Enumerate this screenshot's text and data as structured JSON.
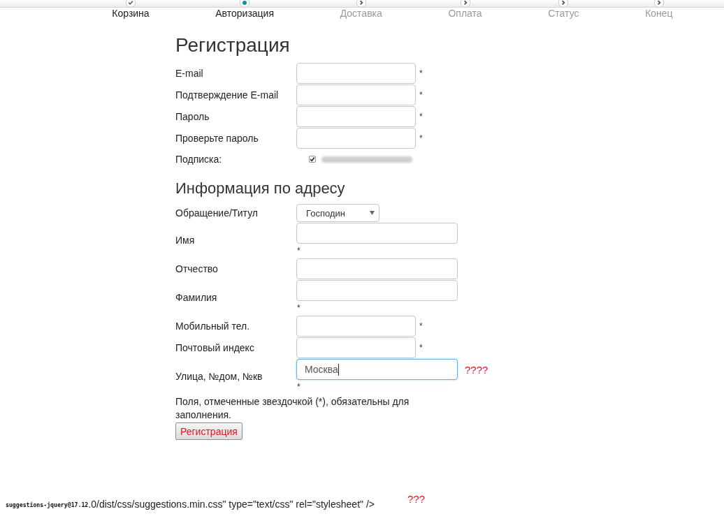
{
  "steps": [
    {
      "label": "Корзина",
      "done": true,
      "selected": false
    },
    {
      "label": "Авторизация",
      "done": false,
      "selected": true
    },
    {
      "label": "Доставка",
      "done": false,
      "selected": false
    },
    {
      "label": "Оплата",
      "done": false,
      "selected": false
    },
    {
      "label": "Статус",
      "done": false,
      "selected": false
    },
    {
      "label": "Конец",
      "done": false,
      "selected": false
    }
  ],
  "registration": {
    "title": "Регистрация",
    "fields": [
      {
        "kind": "short",
        "label": "E-mail",
        "required_mark": "*",
        "focused": false
      },
      {
        "kind": "short",
        "label": "Подтверждение E-mail",
        "required_mark": "*",
        "focused": false
      },
      {
        "kind": "short",
        "label": "Пароль",
        "required_mark": "*",
        "focused": false
      },
      {
        "kind": "short",
        "label": "Проверьте пароль",
        "required_mark": "*",
        "focused": false
      },
      {
        "kind": "checkbox",
        "label": "Подписка:",
        "checked": true,
        "option_blurred": true
      }
    ]
  },
  "address": {
    "title": "Информация по адресу",
    "fields": [
      {
        "kind": "select",
        "label": "Обращение/Титул",
        "value": "Господин"
      },
      {
        "kind": "wide",
        "label": "Имя",
        "required_mark": "*",
        "focused": false
      },
      {
        "kind": "wide",
        "label": "Отчество",
        "focused": false
      },
      {
        "kind": "wide",
        "label": "Фамилия",
        "required_mark": "*",
        "focused": false
      },
      {
        "kind": "short",
        "label": "Мобильный тел.",
        "required_mark": "*",
        "focused": false
      },
      {
        "kind": "short",
        "label": "Почтовый индекс",
        "required_mark": "*",
        "focused": false
      },
      {
        "kind": "wide",
        "label": "Улица, №дом, №кв",
        "value": "Москва",
        "focused": true,
        "required_mark": "*",
        "note": "????"
      }
    ]
  },
  "required_note": "Поля, отмеченные звездочкой (*), обязательны для заполнения.",
  "submit_button": "Регистрация",
  "footer": {
    "code_prefix": "suggestions-jquery@17.12",
    "code_rest": ".0/dist/css/suggestions.min.css\" type=\"text/css\" rel=\"stylesheet\" />",
    "mark": "???"
  }
}
